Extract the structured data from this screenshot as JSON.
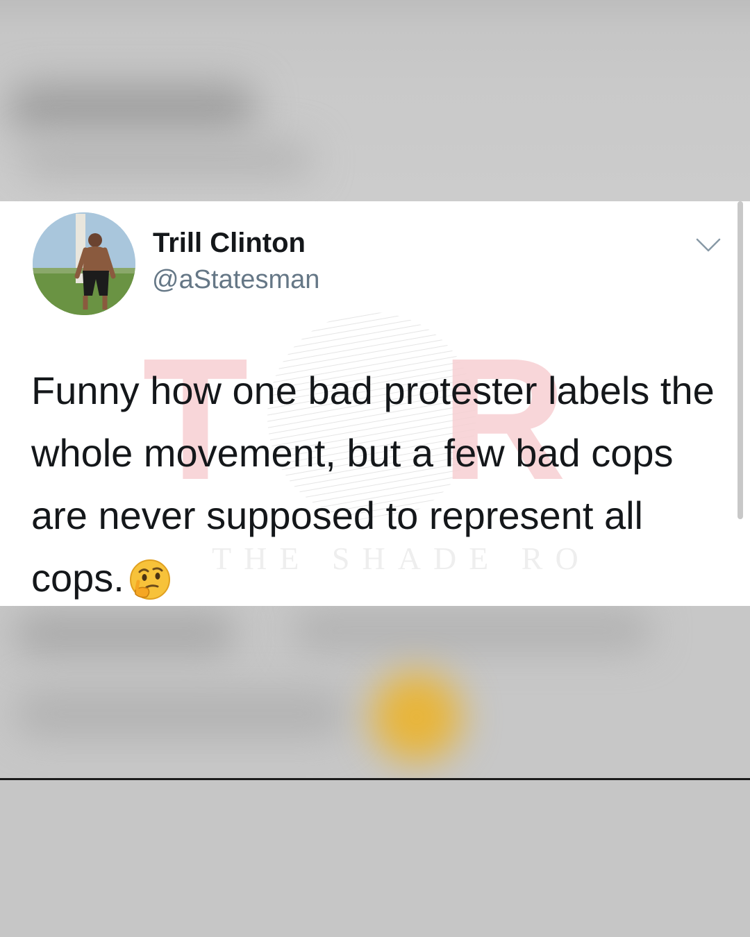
{
  "tweet": {
    "display_name": "Trill Clinton",
    "handle": "@aStatesman",
    "text": "Funny how one bad protester labels the whole movement, but a few bad cops are never supposed to represent all cops.",
    "emoji": "thinking-face"
  },
  "watermark": {
    "logo": "TSR",
    "caption": "THE SHADE ROOM"
  },
  "icons": {
    "menu": "chevron-down-icon"
  },
  "colors": {
    "background": "#c9c9c9",
    "card": "#ffffff",
    "text": "#14171a",
    "handle": "#657786",
    "watermark": "#f2b8bc"
  }
}
